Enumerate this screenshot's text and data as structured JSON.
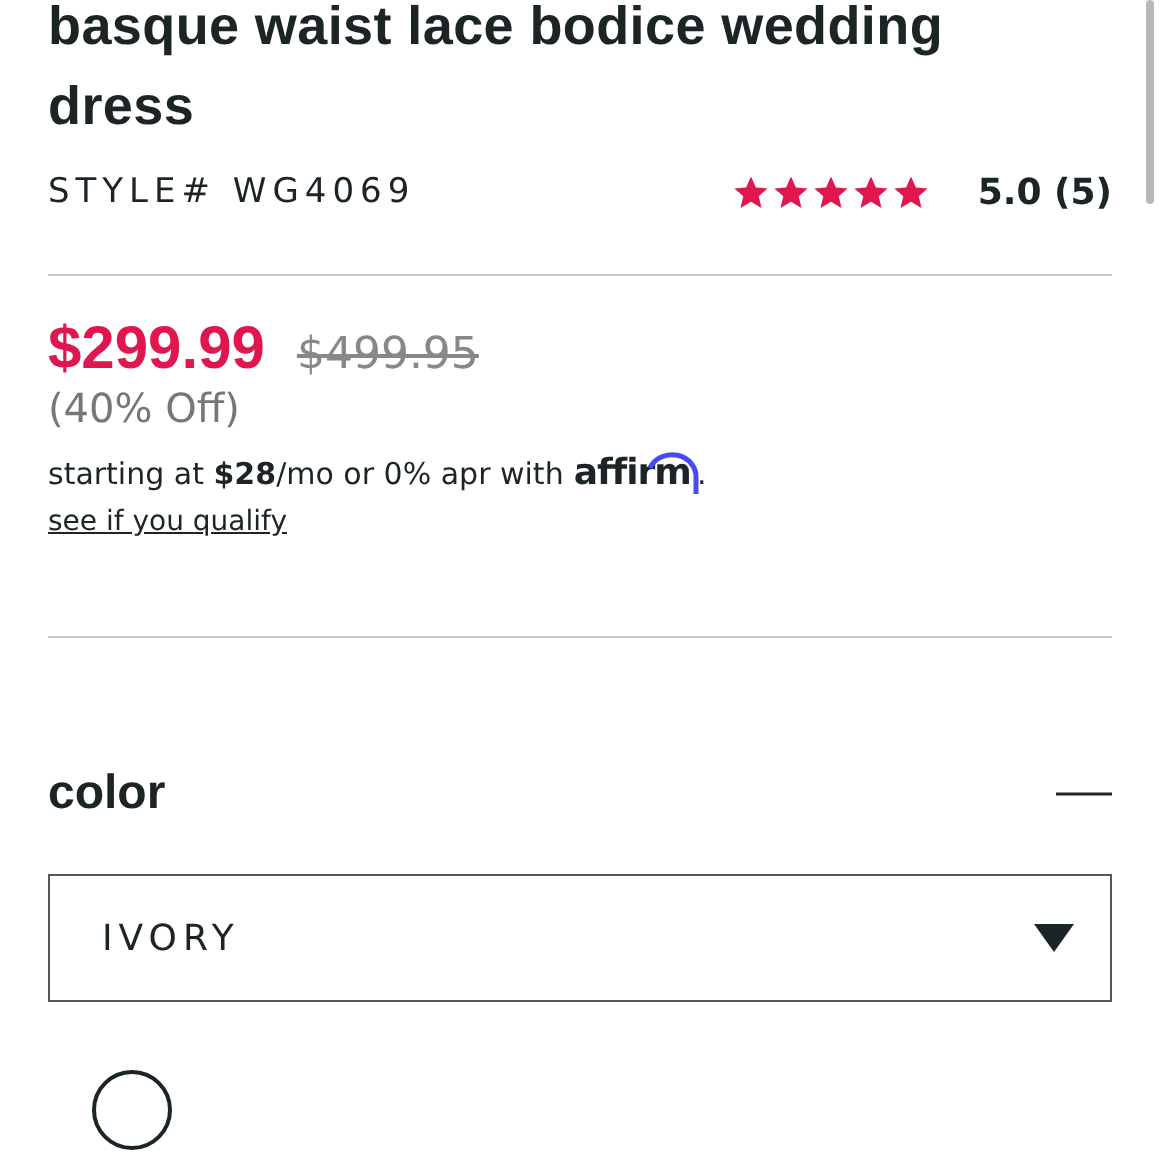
{
  "product": {
    "title": "basque waist lace bodice wedding dress",
    "style_number": "STYLE# WG4069",
    "stars": 5,
    "rating": "5.0 (5)"
  },
  "price": {
    "sale": "$299.99",
    "original": "$499.95",
    "discount": "(40% Off)",
    "financing": "starting at **$28**/mo or 0% apr with",
    "financing_logo": "affirm",
    "financing_end": ".",
    "link": "see if you qualify"
  },
  "color": {
    "heading": "color",
    "expanded": true,
    "selected_value": "IVORY"
  }
}
